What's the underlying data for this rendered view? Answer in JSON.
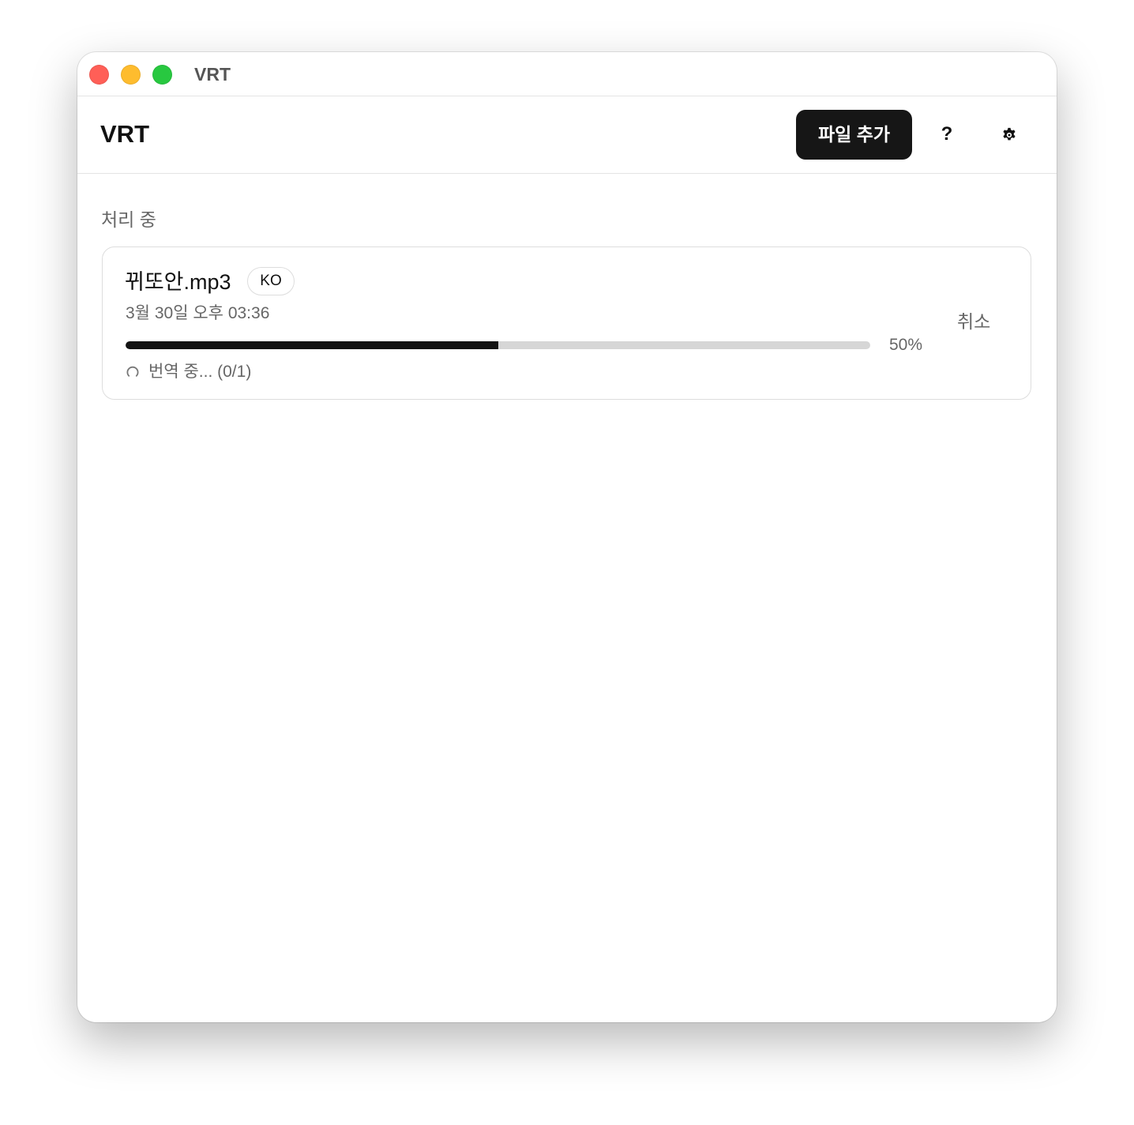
{
  "window": {
    "title": "VRT"
  },
  "header": {
    "title": "VRT",
    "add_file_label": "파일 추가",
    "help_label": "?",
    "settings_icon": "gear-icon"
  },
  "processing": {
    "section_label": "처리 중",
    "jobs": [
      {
        "file_name": "뀌또안.mp3",
        "language": "KO",
        "timestamp": "3월 30일 오후 03:36",
        "progress": 0.5,
        "progress_label": "50%",
        "status": "번역 중... (0/1)",
        "status_icon": "spinner-icon",
        "cancel_label": "취소"
      }
    ]
  },
  "colors": {
    "accent": "#161616",
    "traffic_close": "#ff5f57",
    "traffic_minimize": "#febc2e",
    "traffic_maximize": "#28c840",
    "progress_track": "#d6d6d6",
    "muted_text": "#666666"
  }
}
